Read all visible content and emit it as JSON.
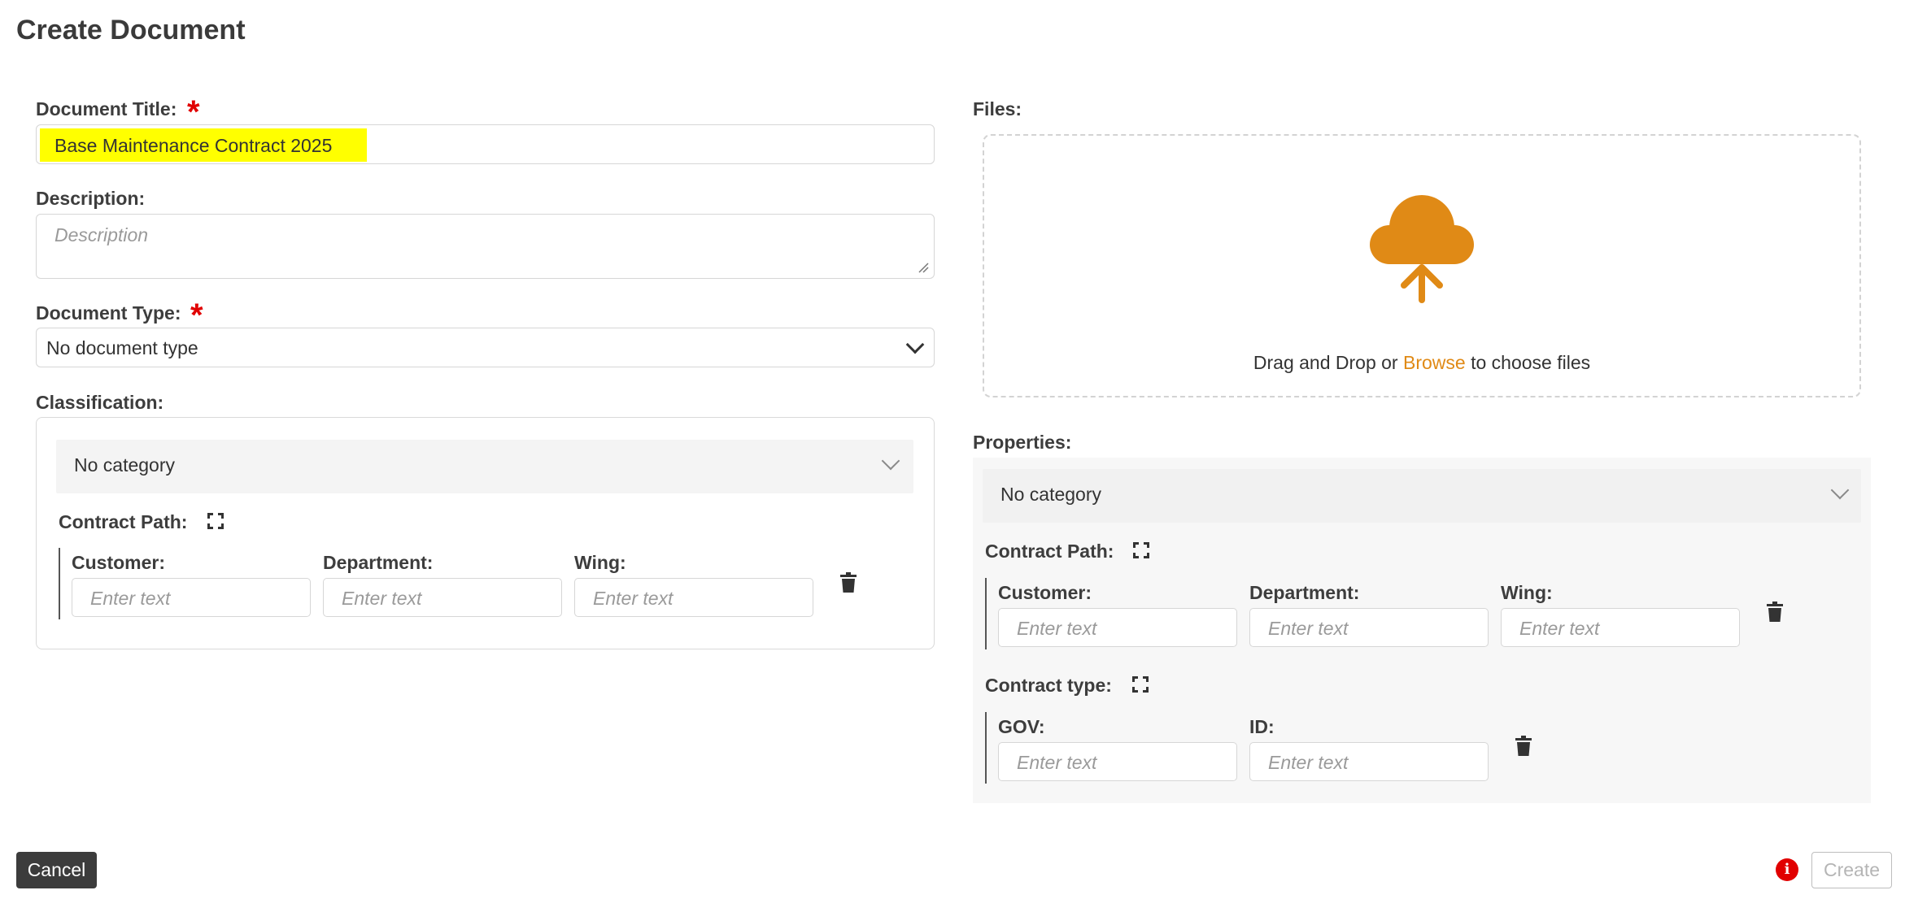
{
  "page": {
    "title": "Create Document"
  },
  "form": {
    "document_title": {
      "label": "Document Title:",
      "required_mark": "*",
      "value": "Base Maintenance Contract 2025"
    },
    "description": {
      "label": "Description:",
      "placeholder": "Description"
    },
    "document_type": {
      "label": "Document Type:",
      "required_mark": "*",
      "selected": "No document type"
    },
    "classification": {
      "label": "Classification:",
      "category_selected": "No category",
      "contract_path": {
        "label": "Contract Path:",
        "fields": [
          {
            "label": "Customer:",
            "placeholder": "Enter text"
          },
          {
            "label": "Department:",
            "placeholder": "Enter text"
          },
          {
            "label": "Wing:",
            "placeholder": "Enter text"
          }
        ]
      }
    }
  },
  "files": {
    "label": "Files:",
    "dropzone": {
      "text_before": "Drag and Drop or ",
      "link": "Browse",
      "text_after": " to choose files",
      "accent_color": "#e08a16"
    }
  },
  "properties": {
    "label": "Properties:",
    "category_selected": "No category",
    "contract_path": {
      "label": "Contract Path:",
      "fields": [
        {
          "label": "Customer:",
          "placeholder": "Enter text"
        },
        {
          "label": "Department:",
          "placeholder": "Enter text"
        },
        {
          "label": "Wing:",
          "placeholder": "Enter text"
        }
      ]
    },
    "contract_type": {
      "label": "Contract type:",
      "fields": [
        {
          "label": "GOV:",
          "placeholder": "Enter text"
        },
        {
          "label": "ID:",
          "placeholder": "Enter text"
        }
      ]
    }
  },
  "footer": {
    "cancel_label": "Cancel",
    "create_label": "Create",
    "info_glyph": "i"
  },
  "icons": {
    "upload": "cloud-upload-icon",
    "expand": "expand-icon",
    "trash": "trash-icon",
    "chevron": "chevron-down-icon",
    "info": "info-icon"
  },
  "colors": {
    "required": "#e10000",
    "highlight": "#ffff00",
    "accent": "#e08a16",
    "info": "#e10000"
  }
}
